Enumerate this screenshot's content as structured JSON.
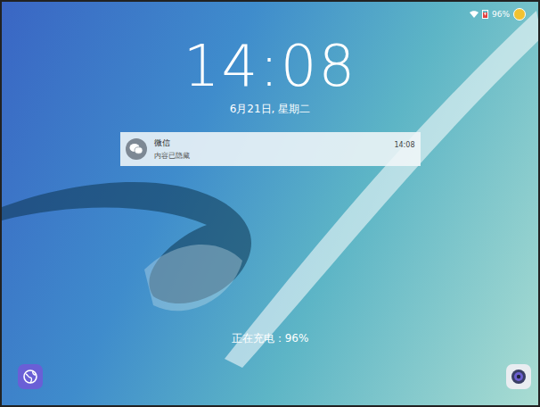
{
  "status_bar": {
    "battery": "96%",
    "battery_level": 0.96,
    "charging": true
  },
  "clock": {
    "time": "14:08",
    "date": "6月21日, 星期二"
  },
  "notifications": [
    {
      "app": "微信",
      "content": "内容已隐藏",
      "time": "14:08"
    }
  ],
  "charging_status": "正在充电：96%"
}
